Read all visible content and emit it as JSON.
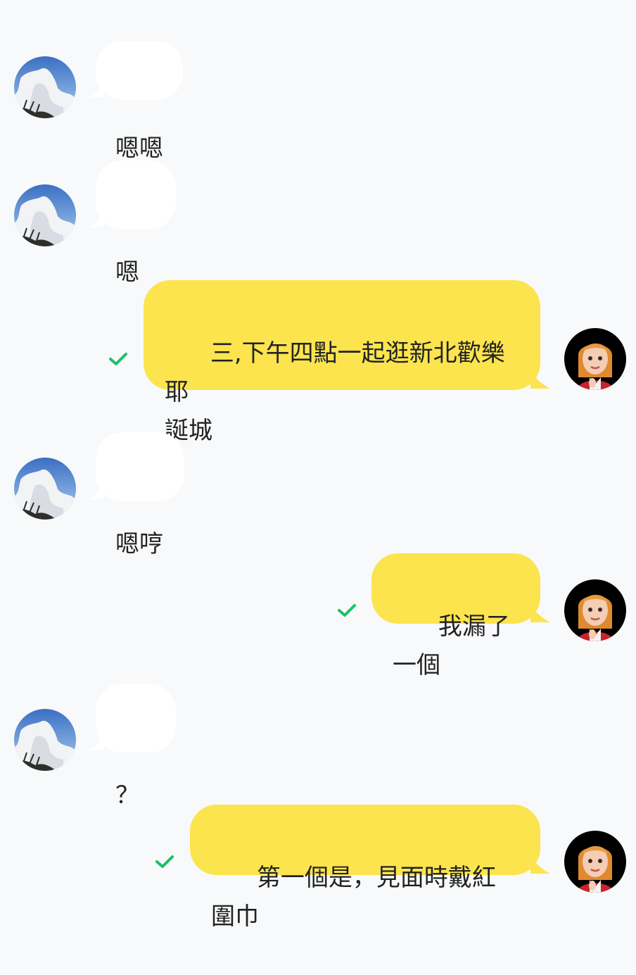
{
  "conversation": {
    "messages": [
      {
        "sender": "contact",
        "text": "嗯嗯"
      },
      {
        "sender": "contact",
        "text": "嗯"
      },
      {
        "sender": "me",
        "text": "三,下午四點一起逛新北歡樂耶\n誕城",
        "status": "read"
      },
      {
        "sender": "contact",
        "text": "嗯哼"
      },
      {
        "sender": "me",
        "text": "我漏了一個",
        "status": "read"
      },
      {
        "sender": "contact",
        "text": "？"
      },
      {
        "sender": "me",
        "text": "第一個是，見面時戴紅圍巾",
        "status": "read"
      }
    ]
  },
  "icons": {
    "contact_avatar": "sky-clouds-avatar",
    "my_avatar": "cartoon-girl-avatar",
    "read_receipt": "check-icon"
  },
  "colors": {
    "background": "#f8f9fa",
    "incoming_bubble": "#ffffff",
    "outgoing_bubble": "#fbe44e",
    "check": "#1fbf66"
  }
}
